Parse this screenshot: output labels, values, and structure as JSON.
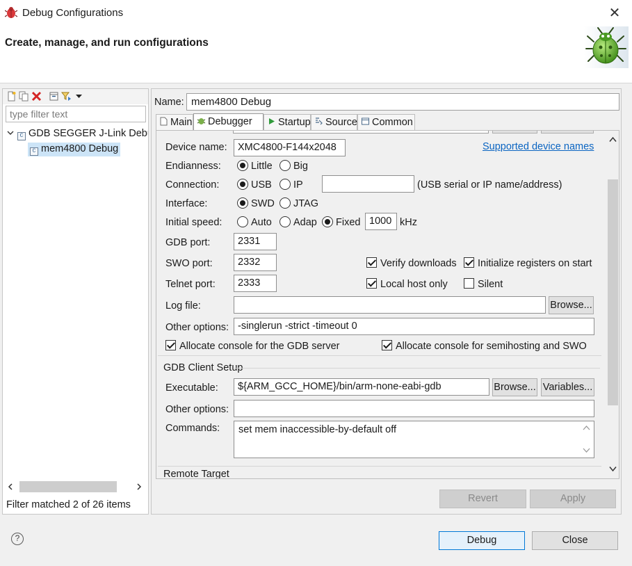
{
  "window": {
    "title": "Debug Configurations",
    "close_glyph": "✕"
  },
  "banner": {
    "title": "Create, manage, and run configurations",
    "icon": "bug-icon"
  },
  "left": {
    "filter_placeholder": "type filter text",
    "tree": {
      "root_label": "GDB SEGGER J-Link Debugging",
      "child_label": "mem4800 Debug"
    },
    "status": "Filter matched 2 of 26 items"
  },
  "right": {
    "name_label": "Name:",
    "name_value": "mem4800 Debug",
    "tabs": [
      {
        "label": "Main"
      },
      {
        "label": "Debugger"
      },
      {
        "label": "Startup"
      },
      {
        "label": "Source"
      },
      {
        "label": "Common"
      }
    ],
    "debugger": {
      "device_label": "Device name:",
      "device_value": "XMC4800-F144x2048",
      "supported_link": "Supported device names",
      "endianness_label": "Endianness:",
      "endian_little": "Little",
      "endian_big": "Big",
      "connection_label": "Connection:",
      "conn_usb": "USB",
      "conn_ip": "IP",
      "conn_hint": "(USB serial or IP name/address)",
      "interface_label": "Interface:",
      "if_swd": "SWD",
      "if_jtag": "JTAG",
      "speed_label": "Initial speed:",
      "speed_auto": "Auto",
      "speed_adaptive": "Adap",
      "speed_fixed": "Fixed",
      "speed_value": "1000",
      "speed_unit": "kHz",
      "gdb_port_label": "GDB port:",
      "gdb_port": "2331",
      "swo_port_label": "SWO port:",
      "swo_port": "2332",
      "telnet_port_label": "Telnet port:",
      "telnet_port": "2333",
      "verify_downloads": "Verify downloads",
      "init_registers": "Initialize registers on start",
      "local_host_only": "Local host only",
      "silent": "Silent",
      "log_file_label": "Log file:",
      "log_file_value": "",
      "browse": "Browse...",
      "other_options_label": "Other options:",
      "server_other_options": "-singlerun -strict -timeout 0",
      "alloc_gdb_console": "Allocate console for the GDB server",
      "alloc_semihost_console": "Allocate console for semihosting and SWO",
      "client_group": "GDB Client Setup",
      "executable_label": "Executable:",
      "executable_value": "${ARM_GCC_HOME}/bin/arm-none-eabi-gdb",
      "variables": "Variables...",
      "client_other_options": "",
      "commands_label": "Commands:",
      "commands_value": "set mem inaccessible-by-default off",
      "remote_group": "Remote Target"
    },
    "revert": "Revert",
    "apply": "Apply"
  },
  "footer": {
    "help_glyph": "?",
    "debug": "Debug",
    "close": "Close"
  }
}
